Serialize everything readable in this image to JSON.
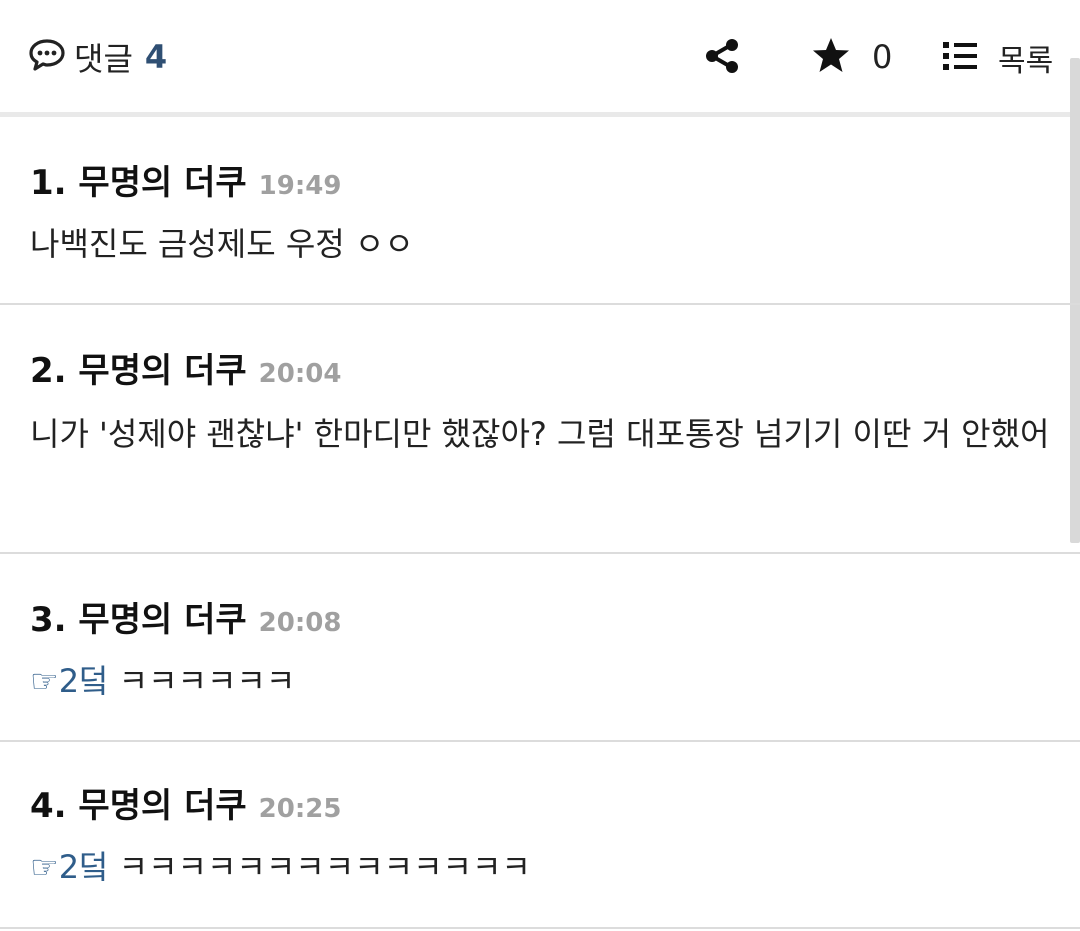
{
  "header": {
    "comments_label": "댓글",
    "comments_count": "4",
    "star_count": "0",
    "list_label": "목록"
  },
  "comments": [
    {
      "num_name": "1. 무명의 더쿠",
      "time": "19:49",
      "reply_to": "",
      "text": "나백진도 금성제도 우정 ㅇㅇ"
    },
    {
      "num_name": "2. 무명의 더쿠",
      "time": "20:04",
      "reply_to": "",
      "text": "니가 '성제야 괜찮냐' 한마디만 했잖아? 그럼 대포통장 넘기기 이딴 거 안했어"
    },
    {
      "num_name": "3. 무명의 더쿠",
      "time": "20:08",
      "reply_to": "☞2덬",
      "text": "ㅋㅋㅋㅋㅋㅋ"
    },
    {
      "num_name": "4. 무명의 더쿠",
      "time": "20:25",
      "reply_to": "☞2덬",
      "text": "ㅋㅋㅋㅋㅋㅋㅋㅋㅋㅋㅋㅋㅋㅋ"
    }
  ],
  "icons": {
    "comment": "speech-bubble-icon",
    "share": "share-icon",
    "star": "star-icon",
    "list": "list-icon"
  },
  "colors": {
    "accent": "#2f4f73",
    "reply_link": "#2f5d8a",
    "time": "#a0a0a0",
    "divider": "#dcdcdc"
  }
}
